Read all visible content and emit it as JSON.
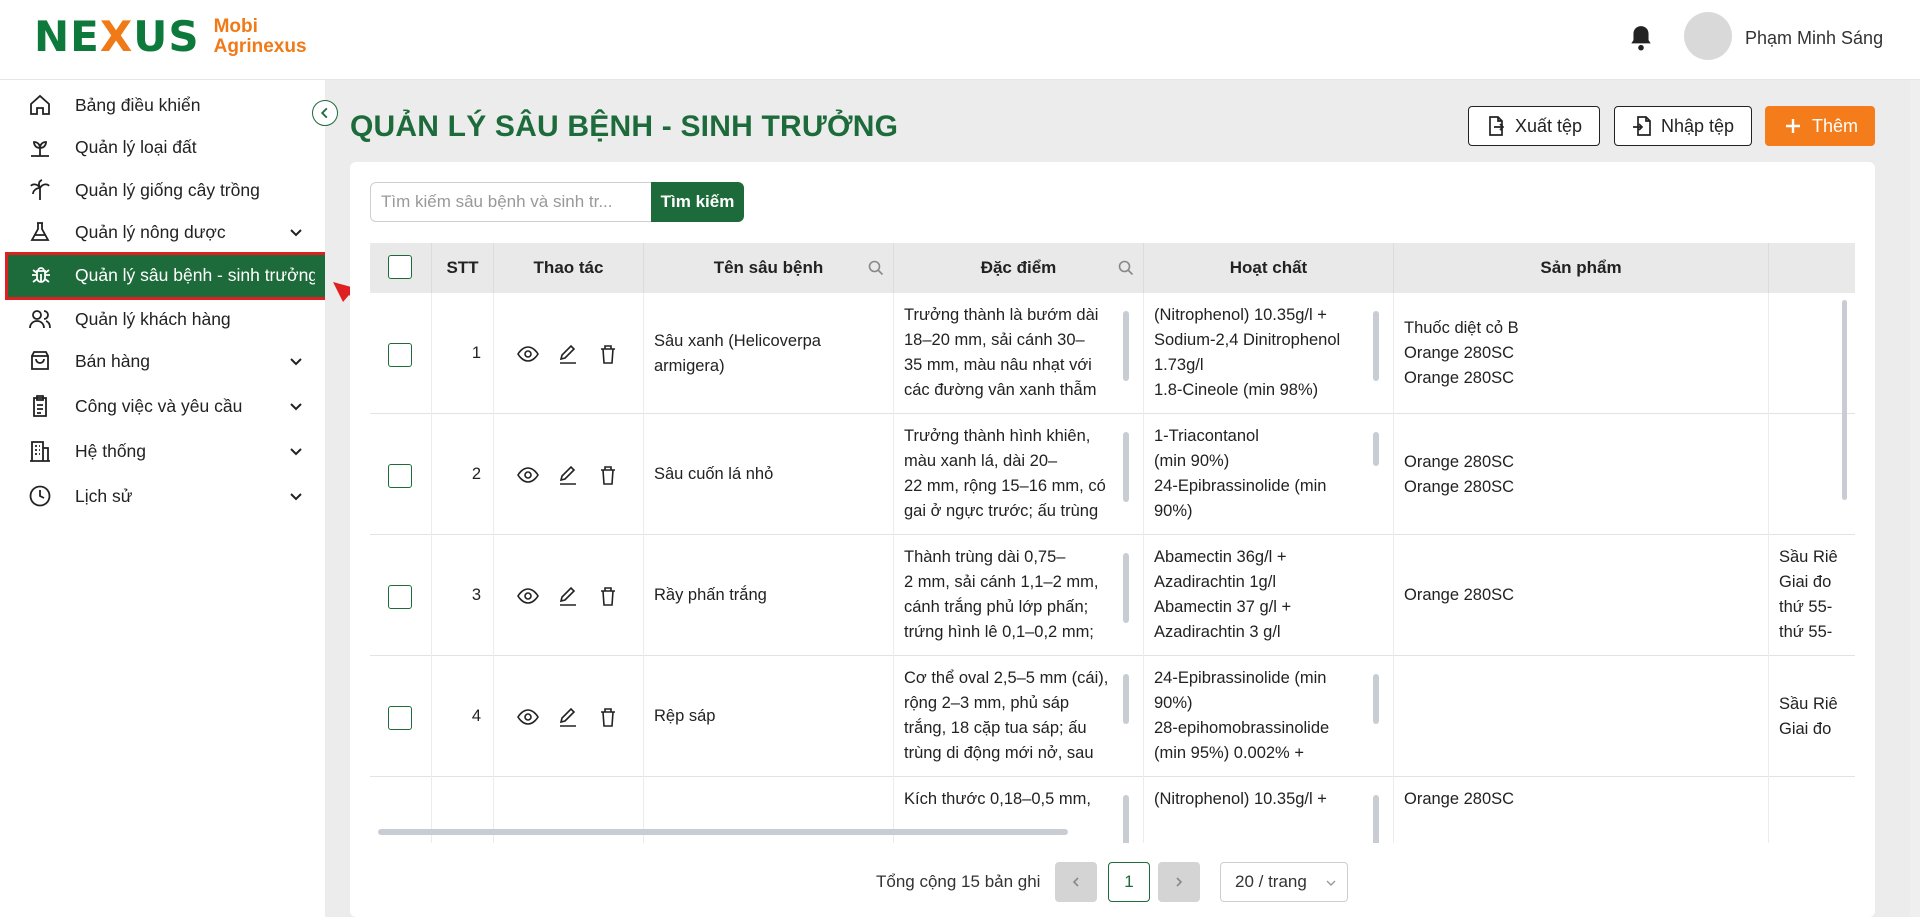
{
  "header": {
    "logo_left": "NE",
    "logo_x": "X",
    "logo_right": "US",
    "brand_line1": "Mobi",
    "brand_line2": "Agrinexus",
    "user_name": "Phạm Minh Sáng"
  },
  "sidebar": {
    "items": [
      {
        "label": "Bảng điều khiển"
      },
      {
        "label": "Quản lý loại đất"
      },
      {
        "label": "Quản lý giống cây trồng"
      },
      {
        "label": "Quản lý nông dược"
      },
      {
        "label": "Quản lý sâu bệnh - sinh trưởng"
      },
      {
        "label": "Quản lý khách hàng"
      },
      {
        "label": "Bán hàng"
      },
      {
        "label": "Công việc và yêu cầu"
      },
      {
        "label": "Hệ thống"
      },
      {
        "label": "Lịch sử"
      }
    ]
  },
  "page": {
    "title": "QUẢN LÝ SÂU BỆNH - SINH TRƯỞNG",
    "export_label": "Xuất tệp",
    "import_label": "Nhập tệp",
    "add_label": "Thêm"
  },
  "search": {
    "placeholder": "Tìm kiếm sâu bệnh và sinh tr...",
    "button_label": "Tìm kiếm"
  },
  "table": {
    "columns": [
      "STT",
      "Thao tác",
      "Tên sâu bệnh",
      "Đặc điểm",
      "Hoạt chất",
      "Sản phẩm"
    ],
    "rows": [
      {
        "stt": "1",
        "name": "Sâu xanh (Helicoverpa armigera)",
        "traits": [
          "Trưởng thành là bướm dài",
          "18–20 mm, sải cánh 30–",
          "35 mm, màu nâu nhạt với",
          "các đường vân xanh thẫm"
        ],
        "ingredients": [
          "(Nitrophenol) 10.35g/l +",
          "Sodium-2,4 Dinitrophenol",
          "1.73g/l",
          "1.8-Cineole (min 98%)"
        ],
        "products": [
          "Thuốc diệt cỏ B",
          "Orange 280SC",
          "Orange 280SC"
        ],
        "extra": []
      },
      {
        "stt": "2",
        "name": "Sâu cuốn lá nhỏ",
        "traits": [
          "Trưởng thành hình khiên,",
          "màu xanh lá, dài 20–",
          "22 mm, rộng 15–16 mm, có",
          "gai ở ngực trước; ấu trùng"
        ],
        "ingredients": [
          "1-Triacontanol",
          "(min 90%)",
          "24-Epibrassinolide (min",
          "90%)"
        ],
        "products": [
          "Orange 280SC",
          "Orange 280SC"
        ],
        "extra": []
      },
      {
        "stt": "3",
        "name": "Rầy phấn trắng",
        "traits": [
          "Thành trùng dài 0,75–",
          "2 mm, sải cánh 1,1–2 mm,",
          "cánh trắng phủ lớp phấn;",
          "trứng hình lê 0,1–0,2 mm;"
        ],
        "ingredients": [
          "Abamectin 36g/l +",
          "Azadirachtin 1g/l",
          "Abamectin 37 g/l +",
          "Azadirachtin 3 g/l"
        ],
        "products": [
          "Orange 280SC"
        ],
        "extra": [
          "Sầu Riê",
          "Giai đo",
          "thứ 55-",
          "thứ 55-"
        ]
      },
      {
        "stt": "4",
        "name": "Rệp sáp",
        "traits": [
          "Cơ thể oval 2,5–5 mm (cái),",
          "rộng 2–3 mm, phủ sáp",
          "trắng, 18 cặp tua sáp; ấu",
          "trùng di động mới nở, sau"
        ],
        "ingredients": [
          "24-Epibrassinolide (min",
          "90%)",
          "28-epihomobrassinolide",
          "(min 95%) 0.002% +"
        ],
        "products": [],
        "extra": [
          "Sầu Riê",
          "Giai đo"
        ]
      },
      {
        "stt": "",
        "name": "",
        "traits": [
          "Kích thước 0,18–0,5 mm,"
        ],
        "ingredients": [
          "(Nitrophenol) 10.35g/l +"
        ],
        "products": [
          "Orange 280SC"
        ],
        "extra": []
      }
    ]
  },
  "pagination": {
    "total_text": "Tổng cộng 15 bản ghi",
    "current_page": "1",
    "page_size": "20 / trang"
  }
}
